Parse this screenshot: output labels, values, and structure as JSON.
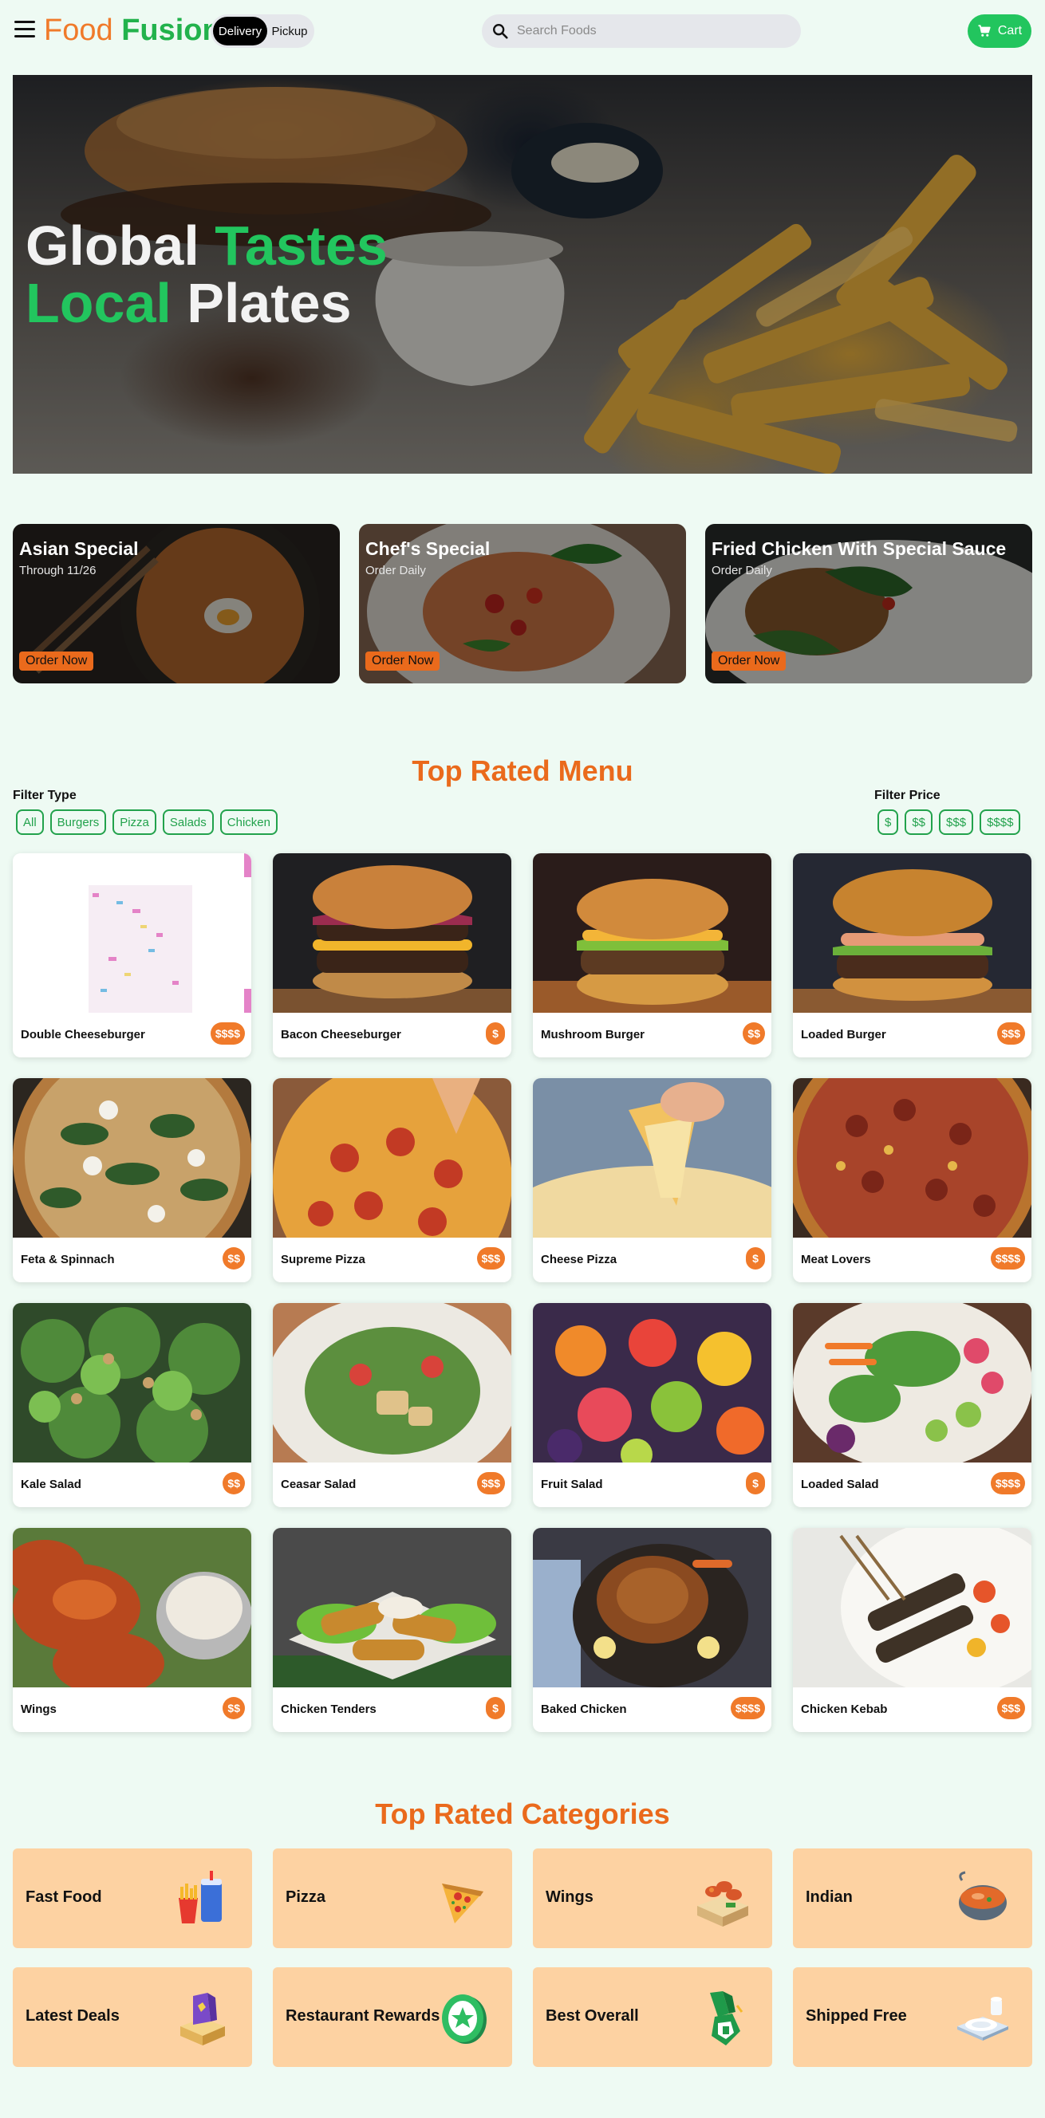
{
  "nav": {
    "brand_part1": "Food",
    "brand_part2": "Fusion",
    "toggle": {
      "active": "Delivery",
      "inactive": "Pickup"
    },
    "search_placeholder": "Search Foods",
    "cart_label": "Cart"
  },
  "hero": {
    "line1_a": "Global",
    "line1_b": "Tastes",
    "line2_a": "Local",
    "line2_b": "Plates"
  },
  "specials": [
    {
      "title": "Asian Special",
      "subtitle": "Through 11/26",
      "button": "Order Now"
    },
    {
      "title": "Chef's Special",
      "subtitle": "Order Daily",
      "button": "Order Now"
    },
    {
      "title": "Fried Chicken With Special Sauce",
      "subtitle": "Order Daily",
      "button": "Order Now"
    }
  ],
  "menu": {
    "title": "Top Rated Menu",
    "filter_type_label": "Filter Type",
    "filter_types": [
      "All",
      "Burgers",
      "Pizza",
      "Salads",
      "Chicken"
    ],
    "filter_price_label": "Filter Price",
    "filter_prices": [
      "$",
      "$$",
      "$$$",
      "$$$$"
    ],
    "items": [
      {
        "name": "Double Cheeseburger",
        "price": "$$$$"
      },
      {
        "name": "Bacon Cheeseburger",
        "price": "$"
      },
      {
        "name": "Mushroom Burger",
        "price": "$$"
      },
      {
        "name": "Loaded Burger",
        "price": "$$$"
      },
      {
        "name": "Feta & Spinnach",
        "price": "$$"
      },
      {
        "name": "Supreme Pizza",
        "price": "$$$"
      },
      {
        "name": "Cheese Pizza",
        "price": "$"
      },
      {
        "name": "Meat Lovers",
        "price": "$$$$"
      },
      {
        "name": "Kale Salad",
        "price": "$$"
      },
      {
        "name": "Ceasar Salad",
        "price": "$$$"
      },
      {
        "name": "Fruit Salad",
        "price": "$"
      },
      {
        "name": "Loaded Salad",
        "price": "$$$$"
      },
      {
        "name": "Wings",
        "price": "$$"
      },
      {
        "name": "Chicken Tenders",
        "price": "$"
      },
      {
        "name": "Baked Chicken",
        "price": "$$$$"
      },
      {
        "name": "Chicken Kebab",
        "price": "$$$"
      }
    ]
  },
  "categories": {
    "title": "Top Rated Categories",
    "items": [
      {
        "label": "Fast Food",
        "icon": "fast-food-icon"
      },
      {
        "label": "Pizza",
        "icon": "pizza-icon"
      },
      {
        "label": "Wings",
        "icon": "wings-icon"
      },
      {
        "label": "Indian",
        "icon": "curry-bowl-icon"
      },
      {
        "label": "Latest Deals",
        "icon": "deals-icon"
      },
      {
        "label": "Restaurant Rewards",
        "icon": "rewards-icon"
      },
      {
        "label": "Best Overall",
        "icon": "best-overall-icon"
      },
      {
        "label": "Shipped Free",
        "icon": "shipped-free-icon"
      }
    ]
  },
  "colors": {
    "accent_orange": "#ea6a1c",
    "accent_green": "#22c55e",
    "page_bg": "#eefaf3",
    "category_bg": "#fdd2a2"
  }
}
